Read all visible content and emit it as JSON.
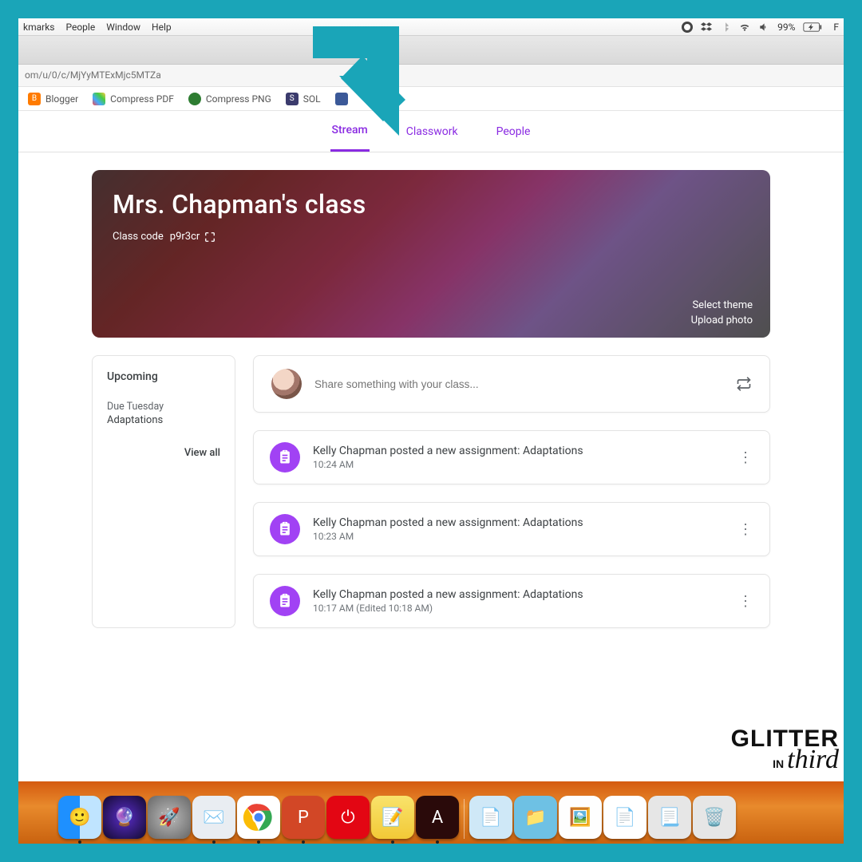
{
  "mac_menu": {
    "items": [
      "kmarks",
      "People",
      "Window",
      "Help"
    ],
    "battery": "99%"
  },
  "url": "om/u/0/c/MjYyMTExMjc5MTZa",
  "bookmarks": [
    {
      "label": "Blogger"
    },
    {
      "label": "Compress PDF"
    },
    {
      "label": "Compress PNG"
    },
    {
      "label": "SOL"
    }
  ],
  "tabs": {
    "stream": "Stream",
    "classwork": "Classwork",
    "people": "People"
  },
  "hero": {
    "title": "Mrs. Chapman's class",
    "code_label": "Class code",
    "code": "p9r3cr",
    "select_theme": "Select theme",
    "upload_photo": "Upload photo"
  },
  "upcoming": {
    "heading": "Upcoming",
    "due": "Due Tuesday",
    "assignment": "Adaptations",
    "view_all": "View all"
  },
  "share_placeholder": "Share something with your class...",
  "posts": [
    {
      "text": "Kelly Chapman posted a new assignment: Adaptations",
      "time": "10:24 AM"
    },
    {
      "text": "Kelly Chapman posted a new assignment: Adaptations",
      "time": "10:23 AM"
    },
    {
      "text": "Kelly Chapman posted a new assignment: Adaptations",
      "time": "10:17 AM (Edited 10:18 AM)"
    }
  ],
  "watermark": {
    "l1": "GLITTER",
    "l2": "IN",
    "l3": "third"
  }
}
